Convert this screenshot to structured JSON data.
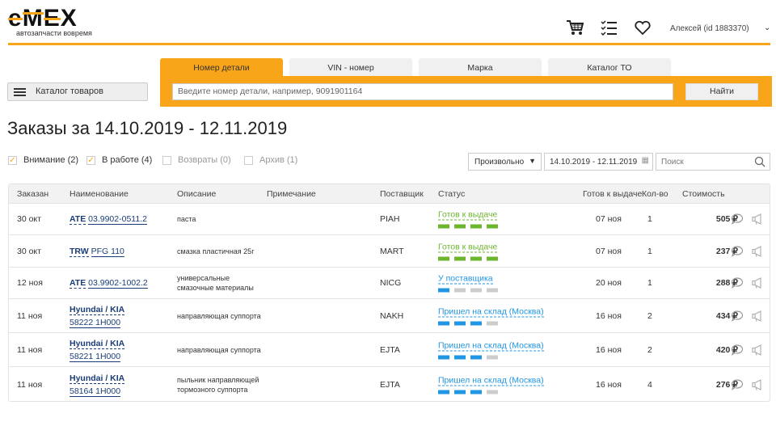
{
  "header": {
    "logo": "e-MEX",
    "tagline": "автозапчасти вовремя",
    "user": "Алексей  (id 1883370)"
  },
  "search": {
    "tabs": [
      "Номер детали",
      "VIN - номер",
      "Марка",
      "Каталог ТО"
    ],
    "placeholder": "Введите номер детали, например, 9091901164",
    "button": "Найти",
    "catalog": "Каталог товаров"
  },
  "title": "Заказы за 14.10.2019 - 12.11.2019",
  "filters": [
    {
      "label": "Внимание (2)",
      "checked": true
    },
    {
      "label": "В работе (4)",
      "checked": true
    },
    {
      "label": "Возвраты (0)",
      "checked": false
    },
    {
      "label": "Архив (1)",
      "checked": false
    }
  ],
  "period": {
    "select": "Произвольно",
    "range": "14.10.2019 - 12.11.2019",
    "search_placeholder": "Поиск"
  },
  "columns": [
    "Заказан",
    "Наименование",
    "Описание",
    "Примечание",
    "Поставщик",
    "Статус",
    "Готов к выдаче",
    "Кол-во",
    "Стоимость"
  ],
  "colors": {
    "accent": "#f9a51a",
    "green": "#6cb52d",
    "blue": "#2196e3"
  },
  "rows": [
    {
      "date": "30 окт",
      "brand": "ATE",
      "part": "03.9902-0511.2",
      "desc": "паста",
      "supplier": "PIAH",
      "status": "Готов к выдаче",
      "color": "green",
      "progress": 4,
      "ready": "07 ноя",
      "qty": "1",
      "price": "505 ₽"
    },
    {
      "date": "30 окт",
      "brand": "TRW",
      "part": "PFG 110",
      "desc": "смазка пластичная 25г",
      "supplier": "MART",
      "status": "Готов к выдаче",
      "color": "green",
      "progress": 4,
      "ready": "07 ноя",
      "qty": "1",
      "price": "237 ₽"
    },
    {
      "date": "12 ноя",
      "brand": "ATE",
      "part": "03.9902-1002.2",
      "desc": "универсальные смазочные материалы",
      "supplier": "NICG",
      "status": "У поставщика",
      "color": "blue",
      "progress": 1,
      "ready": "20 ноя",
      "qty": "1",
      "price": "288 ₽"
    },
    {
      "date": "11 ноя",
      "brand": "Hyundai / KIA",
      "part": "58222 1H000",
      "desc": "направляющая суппорта",
      "supplier": "NAKH",
      "status": "Пришел на склад (Москва)",
      "color": "blue",
      "progress": 3,
      "ready": "16 ноя",
      "qty": "2",
      "price": "434 ₽"
    },
    {
      "date": "11 ноя",
      "brand": "Hyundai / KIA",
      "part": "58221 1H000",
      "desc": "направляющая суппорта",
      "supplier": "EJTA",
      "status": "Пришел на склад (Москва)",
      "color": "blue",
      "progress": 3,
      "ready": "16 ноя",
      "qty": "2",
      "price": "420 ₽"
    },
    {
      "date": "11 ноя",
      "brand": "Hyundai / KIA",
      "part": "58164 1H000",
      "desc": "пыльник направляющей тормозного суппорта",
      "supplier": "EJTA",
      "status": "Пришел на склад (Москва)",
      "color": "blue",
      "progress": 3,
      "ready": "16 ноя",
      "qty": "4",
      "price": "276 ₽"
    }
  ]
}
